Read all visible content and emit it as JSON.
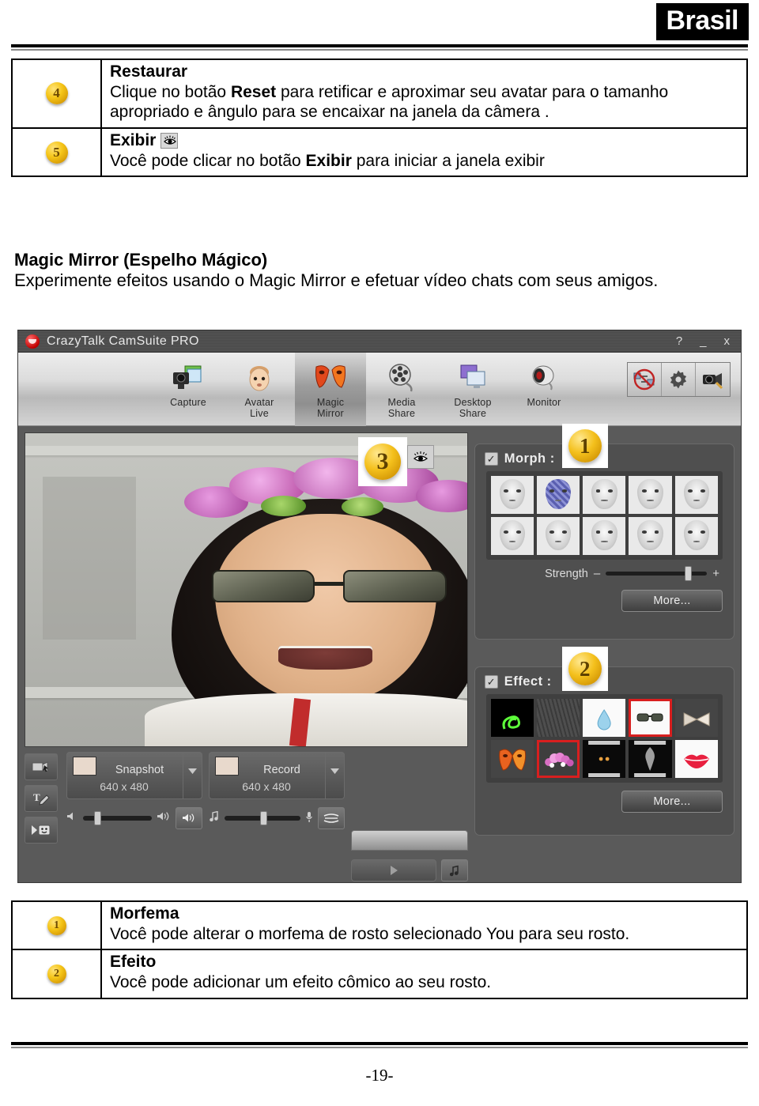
{
  "header": {
    "country_badge": "Brasil"
  },
  "top_table": {
    "rows": [
      {
        "badge": "4",
        "title": "Restaurar",
        "body_parts": [
          "Clique no botão ",
          "Reset",
          " para retificar e aproximar seu avatar para o tamanho apropriado e ângulo para se encaixar na janela da câmera ."
        ]
      },
      {
        "badge": "5",
        "title": "Exibir",
        "title_icon": "eye-icon",
        "body_parts": [
          "Você pode clicar no botão ",
          "Exibir",
          " para iniciar a janela exibir"
        ]
      }
    ]
  },
  "section": {
    "heading": "Magic Mirror (Espelho Mágico)",
    "paragraph": "Experimente efeitos usando o Magic Mirror e efetuar vídeo chats com seus amigos."
  },
  "app": {
    "title": "CrazyTalk CamSuite PRO",
    "window_buttons": [
      {
        "name": "help-button",
        "glyph": "?"
      },
      {
        "name": "minimize-button",
        "glyph": "_"
      },
      {
        "name": "close-button",
        "glyph": "x"
      }
    ],
    "toolbar": {
      "items": [
        {
          "id": "capture",
          "label_line1": "Capture",
          "label_line2": "",
          "icon": "camera-photo-icon",
          "active": false
        },
        {
          "id": "avatar-live",
          "label_line1": "Avatar",
          "label_line2": "Live",
          "icon": "baby-face-icon",
          "active": false
        },
        {
          "id": "magic-mirror",
          "label_line1": "Magic",
          "label_line2": "Mirror",
          "icon": "masks-icon",
          "active": true
        },
        {
          "id": "media-share",
          "label_line1": "Media",
          "label_line2": "Share",
          "icon": "film-reel-icon",
          "active": false
        },
        {
          "id": "desktop-share",
          "label_line1": "Desktop",
          "label_line2": "Share",
          "icon": "monitor-share-icon",
          "active": false
        },
        {
          "id": "monitor",
          "label_line1": "Monitor",
          "label_line2": "",
          "icon": "webcam-icon",
          "active": false
        }
      ],
      "right_buttons": [
        {
          "id": "disable-swap",
          "icon": "no-swap-icon"
        },
        {
          "id": "settings",
          "icon": "gear-icon"
        },
        {
          "id": "camera-settings",
          "icon": "camera-tool-icon"
        }
      ]
    },
    "stage": {
      "overlay_badge": "3",
      "view_button_icon": "eye-icon"
    },
    "bottom": {
      "vertical_tools": [
        {
          "id": "video-tool",
          "icon": "video-cursor-icon"
        },
        {
          "id": "text-tool",
          "icon": "text-pen-icon"
        },
        {
          "id": "emoticon-tool",
          "icon": "emoticon-icon"
        }
      ],
      "snapshot": {
        "label": "Snapshot",
        "resolution": "640 x 480",
        "dropdown_icon": "chevron-down-icon",
        "thumb_icon": "face-thumb-icon"
      },
      "record": {
        "label": "Record",
        "resolution": "640 x 480",
        "dropdown_icon": "chevron-down-icon",
        "thumb_icon": "video-thumb-icon"
      },
      "speaker_slider": {
        "left_icon": "speaker-low-icon",
        "right_icon": "speaker-high-icon",
        "value": 22,
        "mute_button_icon": "speaker-icon"
      },
      "mic_slider": {
        "left_icon": "music-note-icon",
        "right_icon": "microphone-icon",
        "value": 50,
        "button_icon": "voice-changer-icon"
      },
      "play_button_icon": "play-icon",
      "music_button_icon": "music-note-icon"
    },
    "morph_panel": {
      "badge": "1",
      "checkbox_checked": true,
      "check_glyph": "✓",
      "label": "Morph :",
      "strength_label": "Strength",
      "minus": "–",
      "plus": "+",
      "strength_value": 78,
      "more_label": "More...",
      "thumbs": [
        {
          "id": "morph-1",
          "selected": false,
          "style": "plain"
        },
        {
          "id": "morph-2",
          "selected": true,
          "style": "blue"
        },
        {
          "id": "morph-3",
          "selected": false,
          "style": "plain"
        },
        {
          "id": "morph-4",
          "selected": false,
          "style": "plain"
        },
        {
          "id": "morph-5",
          "selected": false,
          "style": "plain"
        },
        {
          "id": "morph-6",
          "selected": false,
          "style": "plain"
        },
        {
          "id": "morph-7",
          "selected": false,
          "style": "plain"
        },
        {
          "id": "morph-8",
          "selected": false,
          "style": "plain"
        },
        {
          "id": "morph-9",
          "selected": false,
          "style": "plain"
        },
        {
          "id": "morph-10",
          "selected": false,
          "style": "plain"
        }
      ]
    },
    "effect_panel": {
      "badge": "2",
      "checkbox_checked": true,
      "check_glyph": "✓",
      "label": "Effect :",
      "more_label": "More...",
      "thumbs": [
        {
          "id": "effect-neon-swirl",
          "icon": "neon-swirl-icon",
          "selected": false
        },
        {
          "id": "effect-rain",
          "icon": "rain-texture-icon",
          "selected": false
        },
        {
          "id": "effect-teardrop",
          "icon": "teardrop-icon",
          "selected": false
        },
        {
          "id": "effect-sunglasses",
          "icon": "sunglasses-icon",
          "selected": true
        },
        {
          "id": "effect-bandage",
          "icon": "bandage-icon",
          "selected": false
        },
        {
          "id": "effect-fire-mask",
          "icon": "fire-mask-icon",
          "selected": false
        },
        {
          "id": "effect-flower-crown",
          "icon": "flower-crown-icon",
          "selected": true
        },
        {
          "id": "effect-dark-eyes",
          "icon": "dark-eyes-icon",
          "selected": false
        },
        {
          "id": "effect-smoke",
          "icon": "smoke-icon",
          "selected": false
        },
        {
          "id": "effect-lips",
          "icon": "red-lips-icon",
          "selected": false
        }
      ]
    }
  },
  "bottom_table": {
    "rows": [
      {
        "badge": "1",
        "title": "Morfema",
        "body": "Você pode alterar o morfema de rosto selecionado You para seu rosto."
      },
      {
        "badge": "2",
        "title": "Efeito",
        "body": "Você pode adicionar um efeito cômico ao seu rosto."
      }
    ]
  },
  "footer": {
    "page_number": "-19-"
  },
  "colors": {
    "badge_gold": "#f4c01c",
    "selection_red": "#d81f1f",
    "app_panel": "#4f4f4f",
    "brasil_bg": "#000000"
  }
}
